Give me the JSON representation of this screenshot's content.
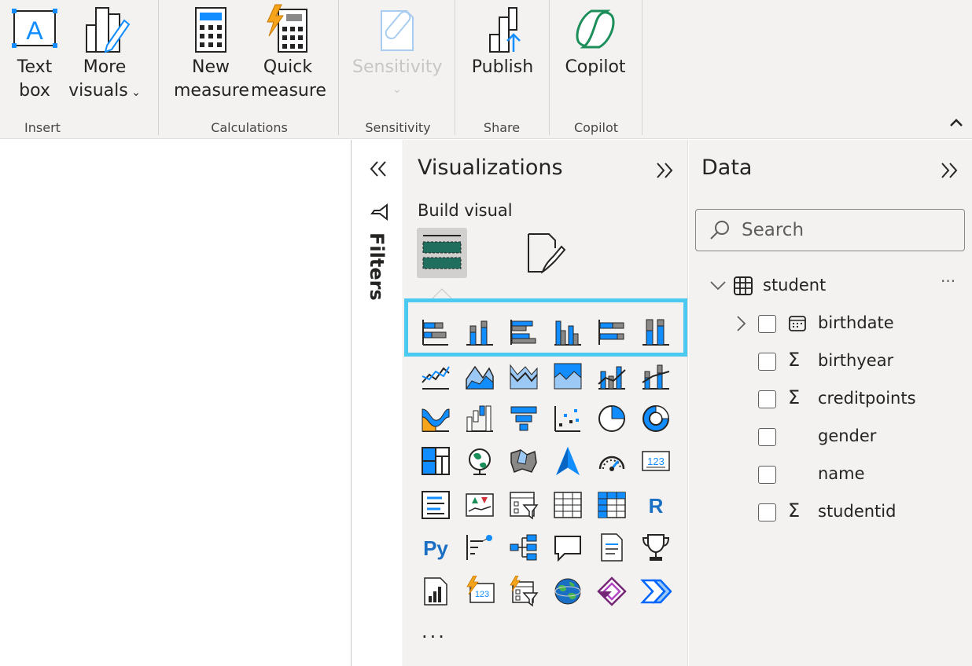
{
  "ribbon": {
    "groups": [
      {
        "title": "Insert",
        "buttons": [
          {
            "label1": "Text",
            "label2": "box"
          },
          {
            "label1": "More",
            "label2": "visuals"
          }
        ]
      },
      {
        "title": "Calculations",
        "buttons": [
          {
            "label1": "New",
            "label2": "measure"
          },
          {
            "label1": "Quick",
            "label2": "measure"
          }
        ]
      },
      {
        "title": "Sensitivity",
        "buttons": [
          {
            "label1": "Sensitivity",
            "label2": ""
          }
        ]
      },
      {
        "title": "Share",
        "buttons": [
          {
            "label1": "Publish",
            "label2": ""
          }
        ]
      },
      {
        "title": "Copilot",
        "buttons": [
          {
            "label1": "Copilot",
            "label2": ""
          }
        ]
      }
    ]
  },
  "filters": {
    "label": "Filters"
  },
  "visualizations": {
    "title": "Visualizations",
    "build_visual": "Build visual",
    "more": "...",
    "icons": [
      "stacked-bar-chart-icon",
      "stacked-column-chart-icon",
      "clustered-bar-chart-icon",
      "clustered-column-chart-icon",
      "100-stacked-bar-chart-icon",
      "100-stacked-column-chart-icon",
      "line-chart-icon",
      "area-chart-icon",
      "stacked-area-chart-icon",
      "100-stacked-area-chart-icon",
      "line-clustered-column-chart-icon",
      "line-stacked-column-chart-icon",
      "ribbon-chart-icon",
      "waterfall-chart-icon",
      "funnel-icon",
      "scatter-chart-icon",
      "pie-chart-icon",
      "donut-chart-icon",
      "treemap-icon",
      "map-icon",
      "filled-map-icon",
      "azure-map-icon",
      "gauge-icon",
      "card-icon",
      "multi-row-card-icon",
      "kpi-icon",
      "slicer-icon",
      "table-icon",
      "matrix-icon",
      "r-visual-icon",
      "python-visual-icon",
      "key-influencers-icon",
      "decomposition-tree-icon",
      "qa-icon",
      "narrative-icon",
      "goals-icon",
      "paginated-report-icon",
      "card-new-icon",
      "slicer-new-icon",
      "arcgis-map-icon",
      "power-apps-icon",
      "power-automate-icon"
    ]
  },
  "data_pane": {
    "title": "Data",
    "search_placeholder": "Search",
    "table": "student",
    "fields": [
      {
        "name": "birthdate",
        "type": "date",
        "expandable": true
      },
      {
        "name": "birthyear",
        "type": "sum",
        "expandable": false
      },
      {
        "name": "creditpoints",
        "type": "sum",
        "expandable": false
      },
      {
        "name": "gender",
        "type": "text",
        "expandable": false
      },
      {
        "name": "name",
        "type": "text",
        "expandable": false
      },
      {
        "name": "studentid",
        "type": "sum",
        "expandable": false
      }
    ],
    "more_options": "···"
  },
  "colors": {
    "accent": "#118dff",
    "highlight": "#4cc9f0",
    "copilot": "#1b8e5a",
    "lightning": "#f7a41d"
  }
}
